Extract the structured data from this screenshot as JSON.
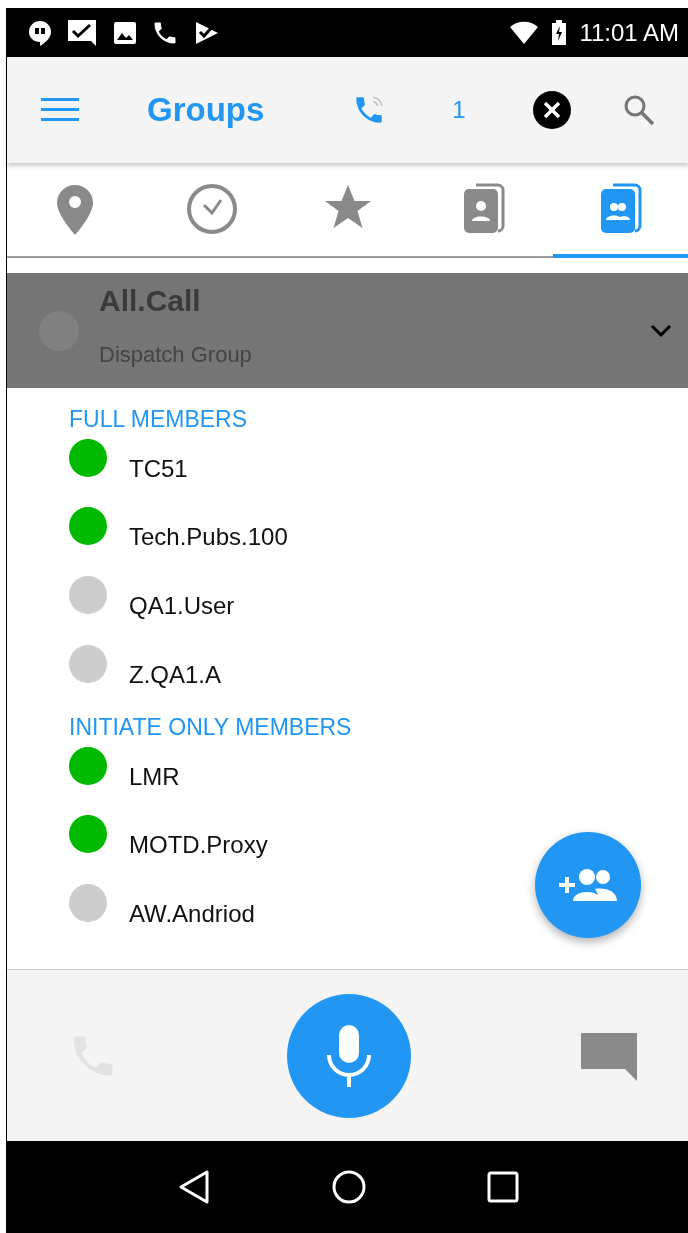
{
  "status_bar": {
    "time": "11:01 AM"
  },
  "app_bar": {
    "title": "Groups",
    "call_count": "1"
  },
  "tabs": [
    {
      "kind": "location",
      "selected": false
    },
    {
      "kind": "recent",
      "selected": false
    },
    {
      "kind": "favorite",
      "selected": false
    },
    {
      "kind": "contact",
      "selected": false
    },
    {
      "kind": "group",
      "selected": true
    }
  ],
  "group": {
    "name": "All.Call",
    "type": "Dispatch Group"
  },
  "sections": [
    {
      "title": "FULL MEMBERS",
      "members": [
        {
          "name": "TC51",
          "online": true
        },
        {
          "name": "Tech.Pubs.100",
          "online": true
        },
        {
          "name": "QA1.User",
          "online": false
        },
        {
          "name": "Z.QA1.A",
          "online": false
        }
      ]
    },
    {
      "title": "INITIATE ONLY MEMBERS",
      "members": [
        {
          "name": "LMR",
          "online": true
        },
        {
          "name": "MOTD.Proxy",
          "online": true
        },
        {
          "name": "AW.Andriod",
          "online": false
        }
      ]
    }
  ]
}
